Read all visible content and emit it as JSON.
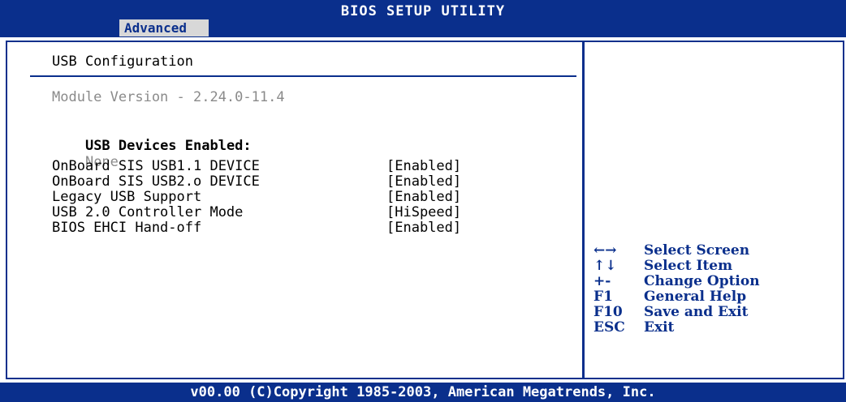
{
  "header": {
    "title": "BIOS SETUP UTILITY",
    "active_tab": "Advanced"
  },
  "panel": {
    "section_title": "USB Configuration",
    "module_version": "Module Version - 2.24.0-11.4",
    "usb_devices_label": "USB Devices Enabled:",
    "usb_devices_value": "None",
    "settings": [
      {
        "label": "OnBoard SIS USB1.1 DEVICE",
        "value": "[Enabled]"
      },
      {
        "label": "OnBoard SIS USB2.o DEVICE",
        "value": "[Enabled]"
      },
      {
        "label": "Legacy USB Support",
        "value": "[Enabled]"
      },
      {
        "label": "USB 2.0 Controller Mode",
        "value": "[HiSpeed]"
      },
      {
        "label": "BIOS EHCI Hand-off",
        "value": "[Enabled]"
      }
    ]
  },
  "help": [
    {
      "key": "←→",
      "action": "Select Screen",
      "icon": "left-right-arrow-icon"
    },
    {
      "key": "↑↓",
      "action": "Select Item",
      "icon": "up-down-arrow-icon"
    },
    {
      "key": "+-",
      "action": "Change Option",
      "icon": "plus-minus-icon"
    },
    {
      "key": "F1",
      "action": "General Help"
    },
    {
      "key": "F10",
      "action": "Save and Exit"
    },
    {
      "key": "ESC",
      "action": "Exit"
    }
  ],
  "footer": {
    "copyright": "v00.00 (C)Copyright 1985-2003, American Megatrends, Inc."
  },
  "colors": {
    "accent": "#0a2f8c",
    "muted_text": "#8a8a8a",
    "tab_bg": "#d8d8d8"
  }
}
